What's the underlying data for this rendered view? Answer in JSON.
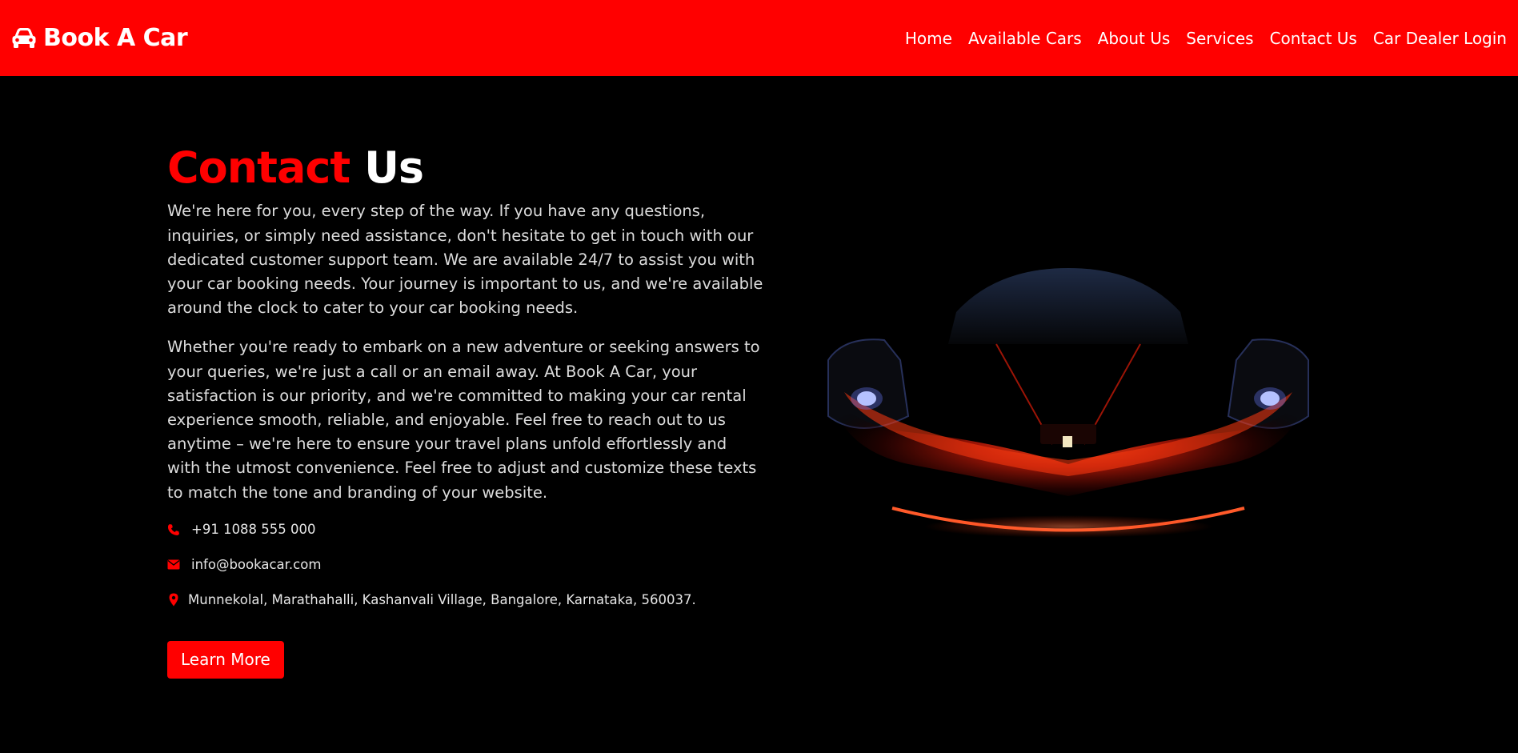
{
  "brand": {
    "name": "Book A Car",
    "icon": "car-icon",
    "color": "#ff0000"
  },
  "nav": {
    "items": [
      {
        "label": "Home"
      },
      {
        "label": "Available Cars"
      },
      {
        "label": "About Us"
      },
      {
        "label": "Services"
      },
      {
        "label": "Contact Us"
      },
      {
        "label": "Car Dealer Login"
      }
    ]
  },
  "hero": {
    "title_accent": "Contact",
    "title_rest": "Us",
    "paragraph1": "We're here for you, every step of the way. If you have any questions, inquiries, or simply need assistance, don't hesitate to get in touch with our dedicated customer support team. We are available 24/7 to assist you with your car booking needs. Your journey is important to us, and we're available around the clock to cater to your car booking needs.",
    "paragraph2": "Whether you're ready to embark on a new adventure or seeking answers to your queries, we're just a call or an email away. At Book A Car, your satisfaction is our priority, and we're committed to making your car rental experience smooth, reliable, and enjoyable. Feel free to reach out to us anytime – we're here to ensure your travel plans unfold effortlessly and with the utmost convenience. Feel free to adjust and customize these texts to match the tone and branding of your website."
  },
  "contact": {
    "phone": {
      "icon": "phone-icon",
      "text": "+91 1088 555 000"
    },
    "email": {
      "icon": "envelope-icon",
      "text": "info@bookacar.com"
    },
    "address": {
      "icon": "map-marker-icon",
      "text": "Munnekolal, Marathahalli, Kashanvali Village, Bangalore, Karnataka, 560037."
    }
  },
  "cta": {
    "label": "Learn More"
  },
  "colors": {
    "accent": "#ff0000",
    "background": "#000000",
    "text": "#dcdcdc"
  }
}
